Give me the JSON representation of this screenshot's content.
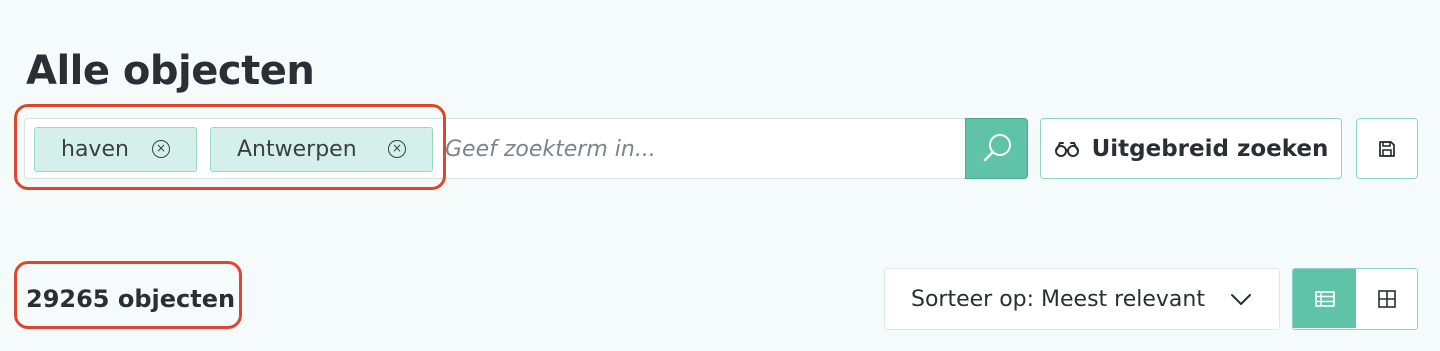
{
  "page": {
    "title": "Alle objecten"
  },
  "search": {
    "chips": [
      {
        "label": "haven"
      },
      {
        "label": "Antwerpen"
      }
    ],
    "placeholder": "Geef zoekterm in...",
    "submit_icon": "search-icon",
    "chip_remove_icon": "close-circle-icon"
  },
  "toolbar": {
    "advanced_label": "Uitgebreid zoeken",
    "advanced_icon": "binoculars-icon",
    "save_icon": "save-icon"
  },
  "results": {
    "count_text": "29265 objecten",
    "sort_label": "Sorteer op: Meest relevant",
    "sort_icon": "chevron-down-icon",
    "view_modes": [
      {
        "name": "list",
        "icon": "list-view-icon",
        "active": true
      },
      {
        "name": "grid",
        "icon": "grid-view-icon",
        "active": false
      }
    ]
  },
  "colors": {
    "accent": "#5ec3a7",
    "chip_bg": "#d5f0ea",
    "highlight": "#e0452f",
    "background": "#f5fafa"
  }
}
